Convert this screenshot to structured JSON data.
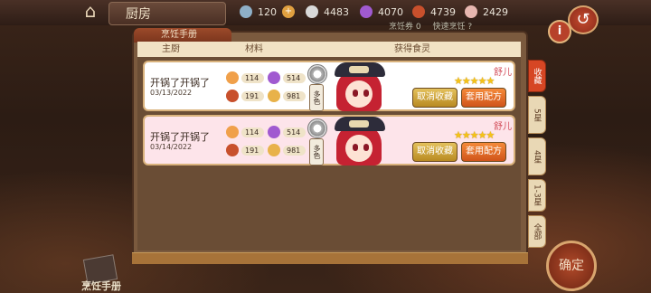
{
  "top_bar": {
    "title": "厨房",
    "currencies": [
      {
        "icon": "fish-icon",
        "value": "120",
        "color": "#8fb0c8"
      },
      {
        "icon": "plus-icon",
        "value": "",
        "color": "#e0a040"
      },
      {
        "icon": "bag-icon",
        "value": "4483",
        "color": "#d9d9d9"
      },
      {
        "icon": "crystal-icon",
        "value": "4070",
        "color": "#a05ad0"
      },
      {
        "icon": "meat-icon",
        "value": "4739",
        "color": "#c8502c"
      },
      {
        "icon": "cake-icon",
        "value": "2429",
        "color": "#e7b7b0"
      }
    ],
    "sub_labels": [
      "烹饪券 0",
      "快速烹饪 ?"
    ]
  },
  "panel": {
    "tab_label": "烹饪手册",
    "columns": [
      "主厨",
      "材料",
      "获得食灵"
    ]
  },
  "rows": [
    {
      "chef": "开锅了开锅了",
      "date": "03/13/2022",
      "materials": [
        {
          "icon": "flask-icon",
          "value": "114",
          "color": "#f0a04a"
        },
        {
          "icon": "crystal-icon",
          "value": "514",
          "color": "#a05ad0"
        },
        {
          "icon": "meat-icon",
          "value": "191",
          "color": "#c8502c"
        },
        {
          "icon": "pudding-icon",
          "value": "981",
          "color": "#e8b24a"
        }
      ],
      "variety_label": "多色",
      "spirit_name": "舒儿",
      "stars": "★★★★★",
      "cancel_label": "取消收藏",
      "apply_label": "套用配方",
      "highlight": "white"
    },
    {
      "chef": "开锅了开锅了",
      "date": "03/14/2022",
      "materials": [
        {
          "icon": "flask-icon",
          "value": "114",
          "color": "#f0a04a"
        },
        {
          "icon": "crystal-icon",
          "value": "514",
          "color": "#a05ad0"
        },
        {
          "icon": "meat-icon",
          "value": "191",
          "color": "#c8502c"
        },
        {
          "icon": "pudding-icon",
          "value": "981",
          "color": "#e8b24a"
        }
      ],
      "variety_label": "多色",
      "spirit_name": "舒儿",
      "stars": "★★★★★",
      "cancel_label": "取消收藏",
      "apply_label": "套用配方",
      "highlight": "pink"
    }
  ],
  "side_tabs": [
    {
      "label": "收藏",
      "active": true
    },
    {
      "label": "5星",
      "active": false
    },
    {
      "label": "4星",
      "active": false
    },
    {
      "label": "1-3星",
      "active": false
    },
    {
      "label": "全部",
      "active": false
    }
  ],
  "confirm_label": "确定",
  "handbook_label": "烹饪手册"
}
